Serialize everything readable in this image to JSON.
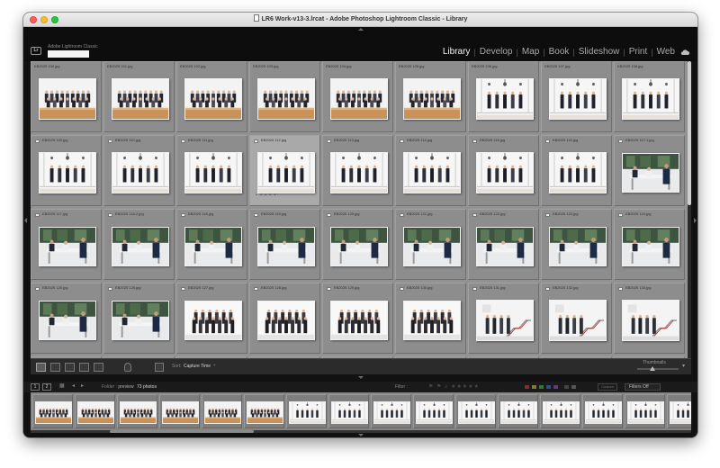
{
  "window": {
    "title": "LR6 Work-v13-3.lrcat - Adobe Photoshop Lightroom Classic - Library"
  },
  "identity": {
    "brand": "Adobe Lightroom Classic",
    "logo": "Lr"
  },
  "modules": [
    {
      "label": "Library",
      "active": true
    },
    {
      "label": "Develop",
      "active": false
    },
    {
      "label": "Map",
      "active": false
    },
    {
      "label": "Book",
      "active": false
    },
    {
      "label": "Slideshow",
      "active": false
    },
    {
      "label": "Print",
      "active": false
    },
    {
      "label": "Web",
      "active": false
    }
  ],
  "grid": {
    "rows": [
      [
        {
          "name": "EB2025 100.jpg",
          "kind": "group-sit"
        },
        {
          "name": "EB2025 101.jpg",
          "kind": "group-sit"
        },
        {
          "name": "EB2025 102.jpg",
          "kind": "group-sit"
        },
        {
          "name": "EB2025 103.jpg",
          "kind": "group-sit"
        },
        {
          "name": "EB2025 104.jpg",
          "kind": "group-sit"
        },
        {
          "name": "EB2025 105.jpg",
          "kind": "group-sit"
        },
        {
          "name": "EB2025 106.jpg",
          "kind": "stand-hall"
        },
        {
          "name": "EB2025 107.jpg",
          "kind": "stand-hall"
        },
        {
          "name": "EB2025 108.jpg",
          "kind": "stand-hall"
        }
      ],
      [
        {
          "name": "EB2025 109.jpg",
          "kind": "stand-hall"
        },
        {
          "name": "EB2025 110.jpg",
          "kind": "stand-hall"
        },
        {
          "name": "EB2025 111.jpg",
          "kind": "stand-hall"
        },
        {
          "name": "EB2025 112.jpg",
          "kind": "stand-hall",
          "selected": true
        },
        {
          "name": "EB2025 113.jpg",
          "kind": "stand-hall"
        },
        {
          "name": "EB2025 114.jpg",
          "kind": "stand-hall"
        },
        {
          "name": "EB2025 115.jpg",
          "kind": "stand-hall"
        },
        {
          "name": "EB2025 116.jpg",
          "kind": "stand-hall"
        },
        {
          "name": "EB2025 117-1.jpg",
          "kind": "meeting"
        }
      ],
      [
        {
          "name": "EB2025 117.jpg",
          "kind": "meeting"
        },
        {
          "name": "EB2025 118-2.jpg",
          "kind": "meeting"
        },
        {
          "name": "EB2025 118.jpg",
          "kind": "meeting"
        },
        {
          "name": "EB2025 119.jpg",
          "kind": "meeting"
        },
        {
          "name": "EB2025 120.jpg",
          "kind": "meeting"
        },
        {
          "name": "EB2025 121.jpg",
          "kind": "meeting"
        },
        {
          "name": "EB2025 122.jpg",
          "kind": "meeting"
        },
        {
          "name": "EB2025 123.jpg",
          "kind": "meeting"
        },
        {
          "name": "EB2025 124.jpg",
          "kind": "meeting"
        }
      ],
      [
        {
          "name": "EB2025 125.jpg",
          "kind": "meeting"
        },
        {
          "name": "EB2025 126.jpg",
          "kind": "meeting"
        },
        {
          "name": "EB2025 127.jpg",
          "kind": "group-dark"
        },
        {
          "name": "EB2025 128.jpg",
          "kind": "group-dark"
        },
        {
          "name": "EB2025 129.jpg",
          "kind": "group-dark"
        },
        {
          "name": "EB2025 130.jpg",
          "kind": "group-dark"
        },
        {
          "name": "EB2025 131.jpg",
          "kind": "stairs"
        },
        {
          "name": "EB2025 132.jpg",
          "kind": "stairs"
        },
        {
          "name": "EB2025 133.jpg",
          "kind": "stairs"
        }
      ],
      [
        {
          "name": "EB2025 134.jpg",
          "kind": "meeting"
        },
        {
          "name": "EB2025 135.jpg",
          "kind": "meeting"
        },
        {
          "name": "EB2025 136.jpg",
          "kind": "group-dark"
        },
        {
          "name": "EB2025 137.jpg",
          "kind": "group-dark"
        },
        {
          "name": "EB2025 138.jpg",
          "kind": "group-dark"
        },
        {
          "name": "EB2025 139.jpg",
          "kind": "stairs"
        },
        {
          "name": "EB2025 140.jpg",
          "kind": "stairs"
        },
        {
          "name": "EB2025 141.jpg",
          "kind": "stairs"
        },
        {
          "name": "EB2025 142.jpg",
          "kind": "stairs"
        }
      ]
    ]
  },
  "toolbar": {
    "sort_label": "Sort:",
    "sort_value": "Capture Time",
    "thumbnails_label": "Thumbnails"
  },
  "filmbar": {
    "page1": "1",
    "page2": "2",
    "folder_prefix": "Folder :",
    "folder_name": "preview",
    "photo_count": "73 photos",
    "filter_label": "Filter :",
    "custom_filter": "Custom",
    "filters_off": "Filters Off"
  },
  "filmstrip": [
    {
      "kind": "group-sit"
    },
    {
      "kind": "group-sit"
    },
    {
      "kind": "group-sit"
    },
    {
      "kind": "group-sit"
    },
    {
      "kind": "group-sit"
    },
    {
      "kind": "group-sit"
    },
    {
      "kind": "stand-hall"
    },
    {
      "kind": "stand-hall"
    },
    {
      "kind": "stand-hall"
    },
    {
      "kind": "stand-hall"
    },
    {
      "kind": "stand-hall"
    },
    {
      "kind": "stand-hall"
    },
    {
      "kind": "stand-hall"
    },
    {
      "kind": "stand-hall"
    },
    {
      "kind": "stand-hall"
    },
    {
      "kind": "stand-hall"
    }
  ]
}
